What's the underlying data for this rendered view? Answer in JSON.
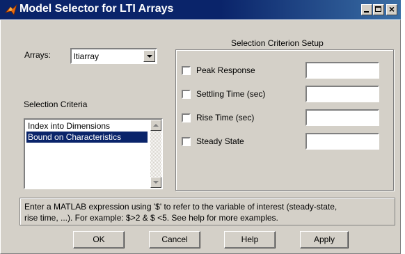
{
  "window": {
    "title": "Model Selector for LTI Arrays",
    "title_buttons": {
      "minimize": "minimize",
      "maximize": "maximize",
      "close": "×"
    }
  },
  "arrays": {
    "label": "Arrays:",
    "selected": "ltiarray"
  },
  "criteria": {
    "label": "Selection Criteria",
    "items": [
      {
        "text": "Index into Dimensions",
        "selected": false
      },
      {
        "text": "Bound on Characteristics",
        "selected": true
      }
    ]
  },
  "setup": {
    "title": "Selection Criterion Setup",
    "rows": [
      {
        "label": "Peak Response",
        "checked": false,
        "value": ""
      },
      {
        "label": "Settling Time (sec)",
        "checked": false,
        "value": ""
      },
      {
        "label": "Rise Time (sec)",
        "checked": false,
        "value": ""
      },
      {
        "label": "Steady State",
        "checked": false,
        "value": ""
      }
    ]
  },
  "help": {
    "line1": "Enter a MATLAB expression using '$' to refer to the variable of  interest (steady-state,",
    "line2": "rise time, ...). For example: $>2 & $ <5. See help for more examples."
  },
  "buttons": {
    "ok": "OK",
    "cancel": "Cancel",
    "help": "Help",
    "apply": "Apply"
  },
  "colors": {
    "titlebar": "#0a246a",
    "face": "#d4d0c8",
    "selection": "#0a246a"
  }
}
